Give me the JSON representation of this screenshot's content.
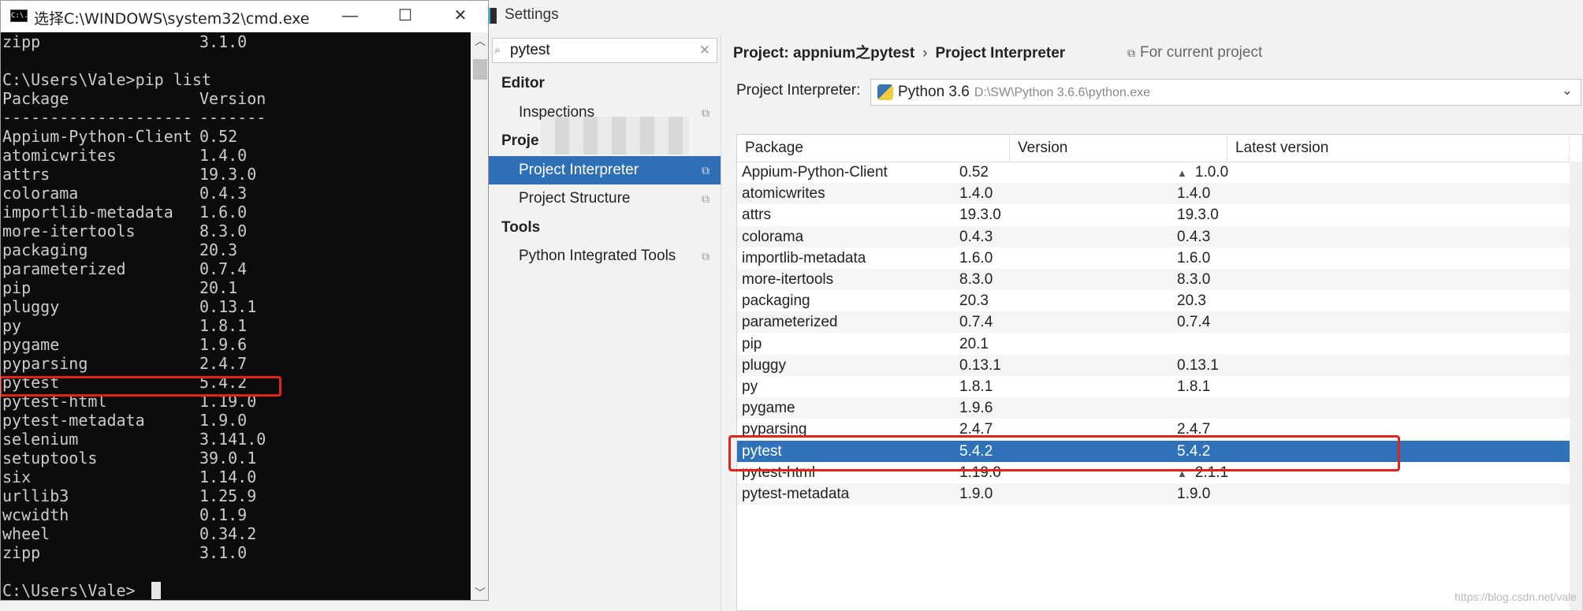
{
  "cmd": {
    "title": "选择C:\\WINDOWS\\system32\\cmd.exe",
    "icon_text": "C:\\.",
    "controls": {
      "minimize": "—",
      "maximize": "☐",
      "close": "✕"
    },
    "lines": [
      [
        "zipp",
        "3.1.0"
      ],
      [
        "",
        ""
      ],
      [
        "C:\\Users\\Vale>pip list",
        ""
      ],
      [
        "Package",
        "Version"
      ],
      [
        "--------------------",
        "-------"
      ],
      [
        "Appium-Python-Client",
        "0.52"
      ],
      [
        "atomicwrites",
        "1.4.0"
      ],
      [
        "attrs",
        "19.3.0"
      ],
      [
        "colorama",
        "0.4.3"
      ],
      [
        "importlib-metadata",
        "1.6.0"
      ],
      [
        "more-itertools",
        "8.3.0"
      ],
      [
        "packaging",
        "20.3"
      ],
      [
        "parameterized",
        "0.7.4"
      ],
      [
        "pip",
        "20.1"
      ],
      [
        "pluggy",
        "0.13.1"
      ],
      [
        "py",
        "1.8.1"
      ],
      [
        "pygame",
        "1.9.6"
      ],
      [
        "pyparsing",
        "2.4.7"
      ],
      [
        "pytest",
        "5.4.2"
      ],
      [
        "pytest-html",
        "1.19.0"
      ],
      [
        "pytest-metadata",
        "1.9.0"
      ],
      [
        "selenium",
        "3.141.0"
      ],
      [
        "setuptools",
        "39.0.1"
      ],
      [
        "six",
        "1.14.0"
      ],
      [
        "urllib3",
        "1.25.9"
      ],
      [
        "wcwidth",
        "0.1.9"
      ],
      [
        "wheel",
        "0.34.2"
      ],
      [
        "zipp",
        "3.1.0"
      ],
      [
        "",
        ""
      ],
      [
        "C:\\Users\\Vale>",
        ""
      ]
    ]
  },
  "settings": {
    "title": "Settings",
    "search_value": "pytest",
    "nav": [
      {
        "label": "Editor",
        "type": "group"
      },
      {
        "label": "Inspections",
        "type": "child"
      },
      {
        "label": "Proje",
        "type": "group"
      },
      {
        "label": "Project Interpreter",
        "type": "child",
        "selected": true
      },
      {
        "label": "Project Structure",
        "type": "child"
      },
      {
        "label": "Tools",
        "type": "group"
      },
      {
        "label": "Python Integrated Tools",
        "type": "child"
      }
    ],
    "breadcrumb": {
      "project": "Project: appnium之pytest",
      "sep": "›",
      "page": "Project Interpreter"
    },
    "for_current_project": "For current project",
    "interpreter_label": "Project Interpreter:",
    "interpreter_name": "Python 3.6",
    "interpreter_path": "D:\\SW\\Python 3.6.6\\python.exe",
    "table": {
      "headers": [
        "Package",
        "Version",
        "Latest version"
      ],
      "rows": [
        {
          "pkg": "Appium-Python-Client",
          "ver": "0.52",
          "latest": "1.0.0",
          "upgrade": true
        },
        {
          "pkg": "atomicwrites",
          "ver": "1.4.0",
          "latest": "1.4.0"
        },
        {
          "pkg": "attrs",
          "ver": "19.3.0",
          "latest": "19.3.0"
        },
        {
          "pkg": "colorama",
          "ver": "0.4.3",
          "latest": "0.4.3"
        },
        {
          "pkg": "importlib-metadata",
          "ver": "1.6.0",
          "latest": "1.6.0"
        },
        {
          "pkg": "more-itertools",
          "ver": "8.3.0",
          "latest": "8.3.0"
        },
        {
          "pkg": "packaging",
          "ver": "20.3",
          "latest": "20.3"
        },
        {
          "pkg": "parameterized",
          "ver": "0.7.4",
          "latest": "0.7.4"
        },
        {
          "pkg": "pip",
          "ver": "20.1",
          "latest": ""
        },
        {
          "pkg": "pluggy",
          "ver": "0.13.1",
          "latest": "0.13.1"
        },
        {
          "pkg": "py",
          "ver": "1.8.1",
          "latest": "1.8.1"
        },
        {
          "pkg": "pygame",
          "ver": "1.9.6",
          "latest": ""
        },
        {
          "pkg": "pyparsing",
          "ver": "2.4.7",
          "latest": "2.4.7"
        },
        {
          "pkg": "pytest",
          "ver": "5.4.2",
          "latest": "5.4.2",
          "selected": true
        },
        {
          "pkg": "pytest-html",
          "ver": "1.19.0",
          "latest": "2.1.1",
          "upgrade": true
        },
        {
          "pkg": "pytest-metadata",
          "ver": "1.9.0",
          "latest": "1.9.0"
        }
      ]
    }
  },
  "watermark": "https://blog.csdn.net/vale",
  "colors": {
    "highlight_box": "#e2231a",
    "selection": "#2f72ba"
  }
}
